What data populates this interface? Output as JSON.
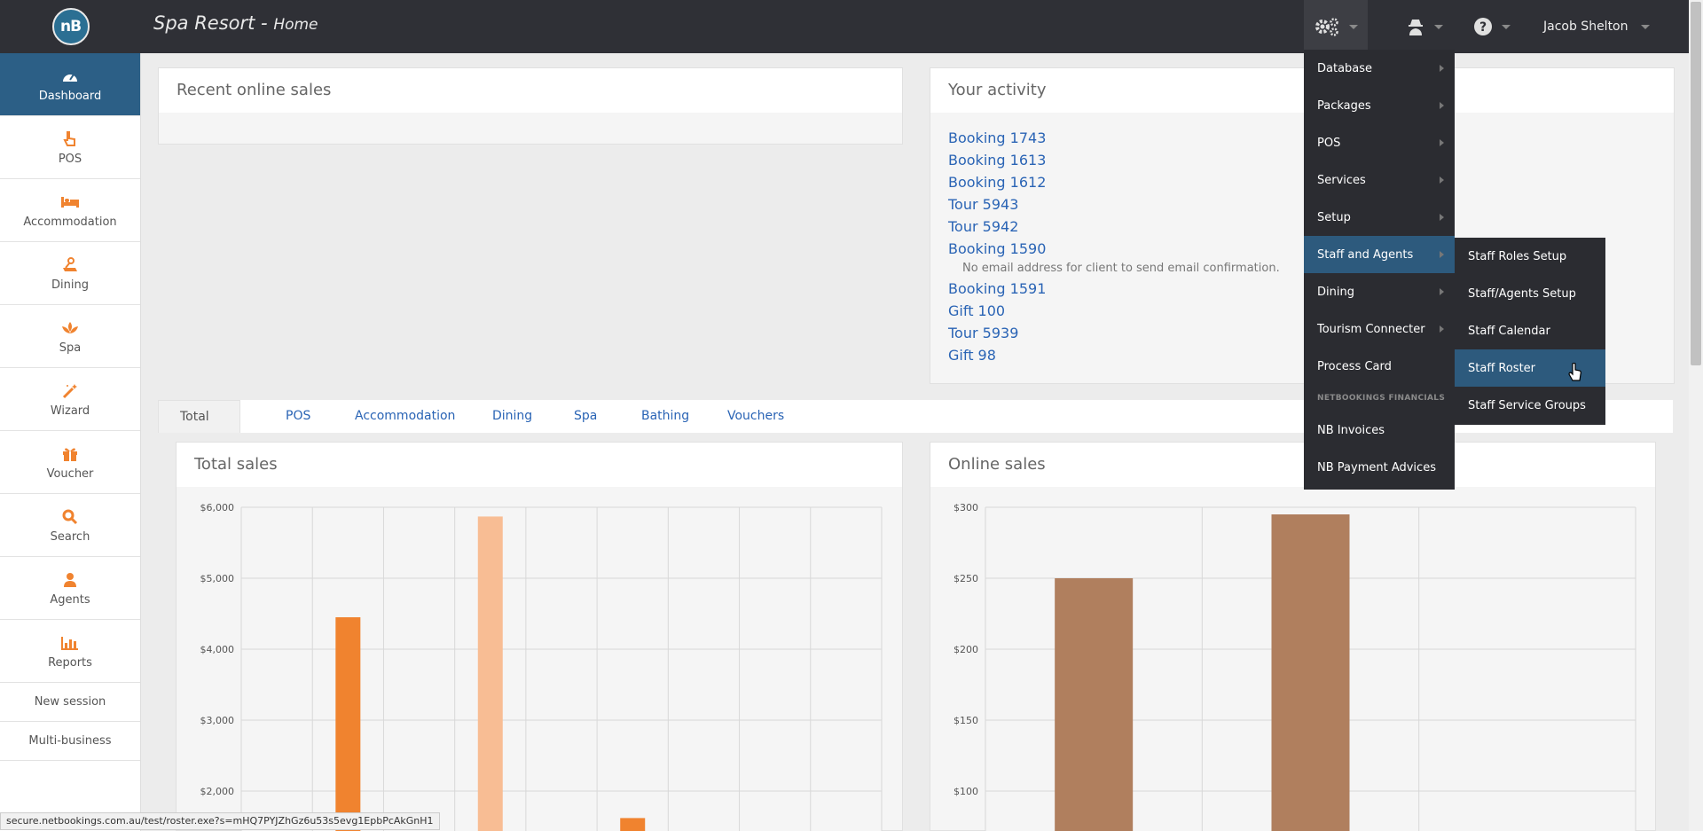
{
  "header": {
    "logo_text": "nB",
    "app_title": "Spa Resort - ",
    "app_page": "Home",
    "user_name": "Jacob Shelton"
  },
  "sidebar": {
    "items": [
      {
        "label": "Dashboard",
        "icon": "dashboard-icon"
      },
      {
        "label": "POS",
        "icon": "hand-pointer-icon"
      },
      {
        "label": "Accommodation",
        "icon": "bed-icon"
      },
      {
        "label": "Dining",
        "icon": "dining-icon"
      },
      {
        "label": "Spa",
        "icon": "lotus-icon"
      },
      {
        "label": "Wizard",
        "icon": "magic-wand-icon"
      },
      {
        "label": "Voucher",
        "icon": "gift-icon"
      },
      {
        "label": "Search",
        "icon": "search-icon"
      },
      {
        "label": "Agents",
        "icon": "user-icon"
      },
      {
        "label": "Reports",
        "icon": "bar-chart-icon"
      }
    ],
    "extra": [
      "New session",
      "Multi-business"
    ]
  },
  "recent_sales": {
    "title": "Recent online sales"
  },
  "activity": {
    "title": "Your activity",
    "items": [
      "Booking 1743",
      "Booking 1613",
      "Booking 1612",
      "Tour 5943",
      "Tour 5942",
      "Booking 1590",
      "No email address for client to send email confirmation.",
      "Booking 1591",
      "Gift 100",
      "Tour 5939",
      "Gift 98"
    ]
  },
  "tabs": [
    "Total sales",
    "POS",
    "Accommodation",
    "Dining",
    "Spa",
    "Bathing",
    "Vouchers"
  ],
  "menu": {
    "items": [
      "Database",
      "Packages",
      "POS",
      "Services",
      "Setup",
      "Staff and Agents",
      "Dining",
      "Tourism Connecter",
      "Process Card"
    ],
    "section": "NETBOOKINGS FINANCIALS",
    "financial_items": [
      "NB Invoices",
      "NB Payment Advices"
    ],
    "submenu": [
      "Staff Roles Setup",
      "Staff/Agents Setup",
      "Staff Calendar",
      "Staff Roster",
      "Staff Service Groups"
    ]
  },
  "status_url": "secure.netbookings.com.au/test/roster.exe?s=mHQ7PYJZhGz6u53s5evg1EpbPcAkGnH1",
  "colors": {
    "accent": "#2c5f86",
    "orange": "#f0832f",
    "light_orange": "#f8bd94",
    "brown": "#b07f5e"
  },
  "chart_data": [
    {
      "type": "bar",
      "title": "Total sales",
      "yticks": [
        "$6,000",
        "$5,000",
        "$4,000",
        "$3,000",
        "$2,000"
      ],
      "ylim": [
        1500,
        6000
      ],
      "slots": 9,
      "bars": [
        {
          "slot": 1,
          "value": 4450,
          "color": "#f0832f"
        },
        {
          "slot": 3,
          "value": 5870,
          "color": "#f8bd94"
        },
        {
          "slot": 5,
          "value": 1620,
          "color": "#f0832f"
        }
      ]
    },
    {
      "type": "bar",
      "title": "Online sales",
      "yticks": [
        "$300",
        "$250",
        "$200",
        "$150",
        "$100"
      ],
      "ylim": [
        80,
        300
      ],
      "slots": 3,
      "bars": [
        {
          "slot": 0,
          "value": 250,
          "color": "#b07f5e"
        },
        {
          "slot": 1,
          "value": 295,
          "color": "#b07f5e"
        }
      ]
    }
  ]
}
